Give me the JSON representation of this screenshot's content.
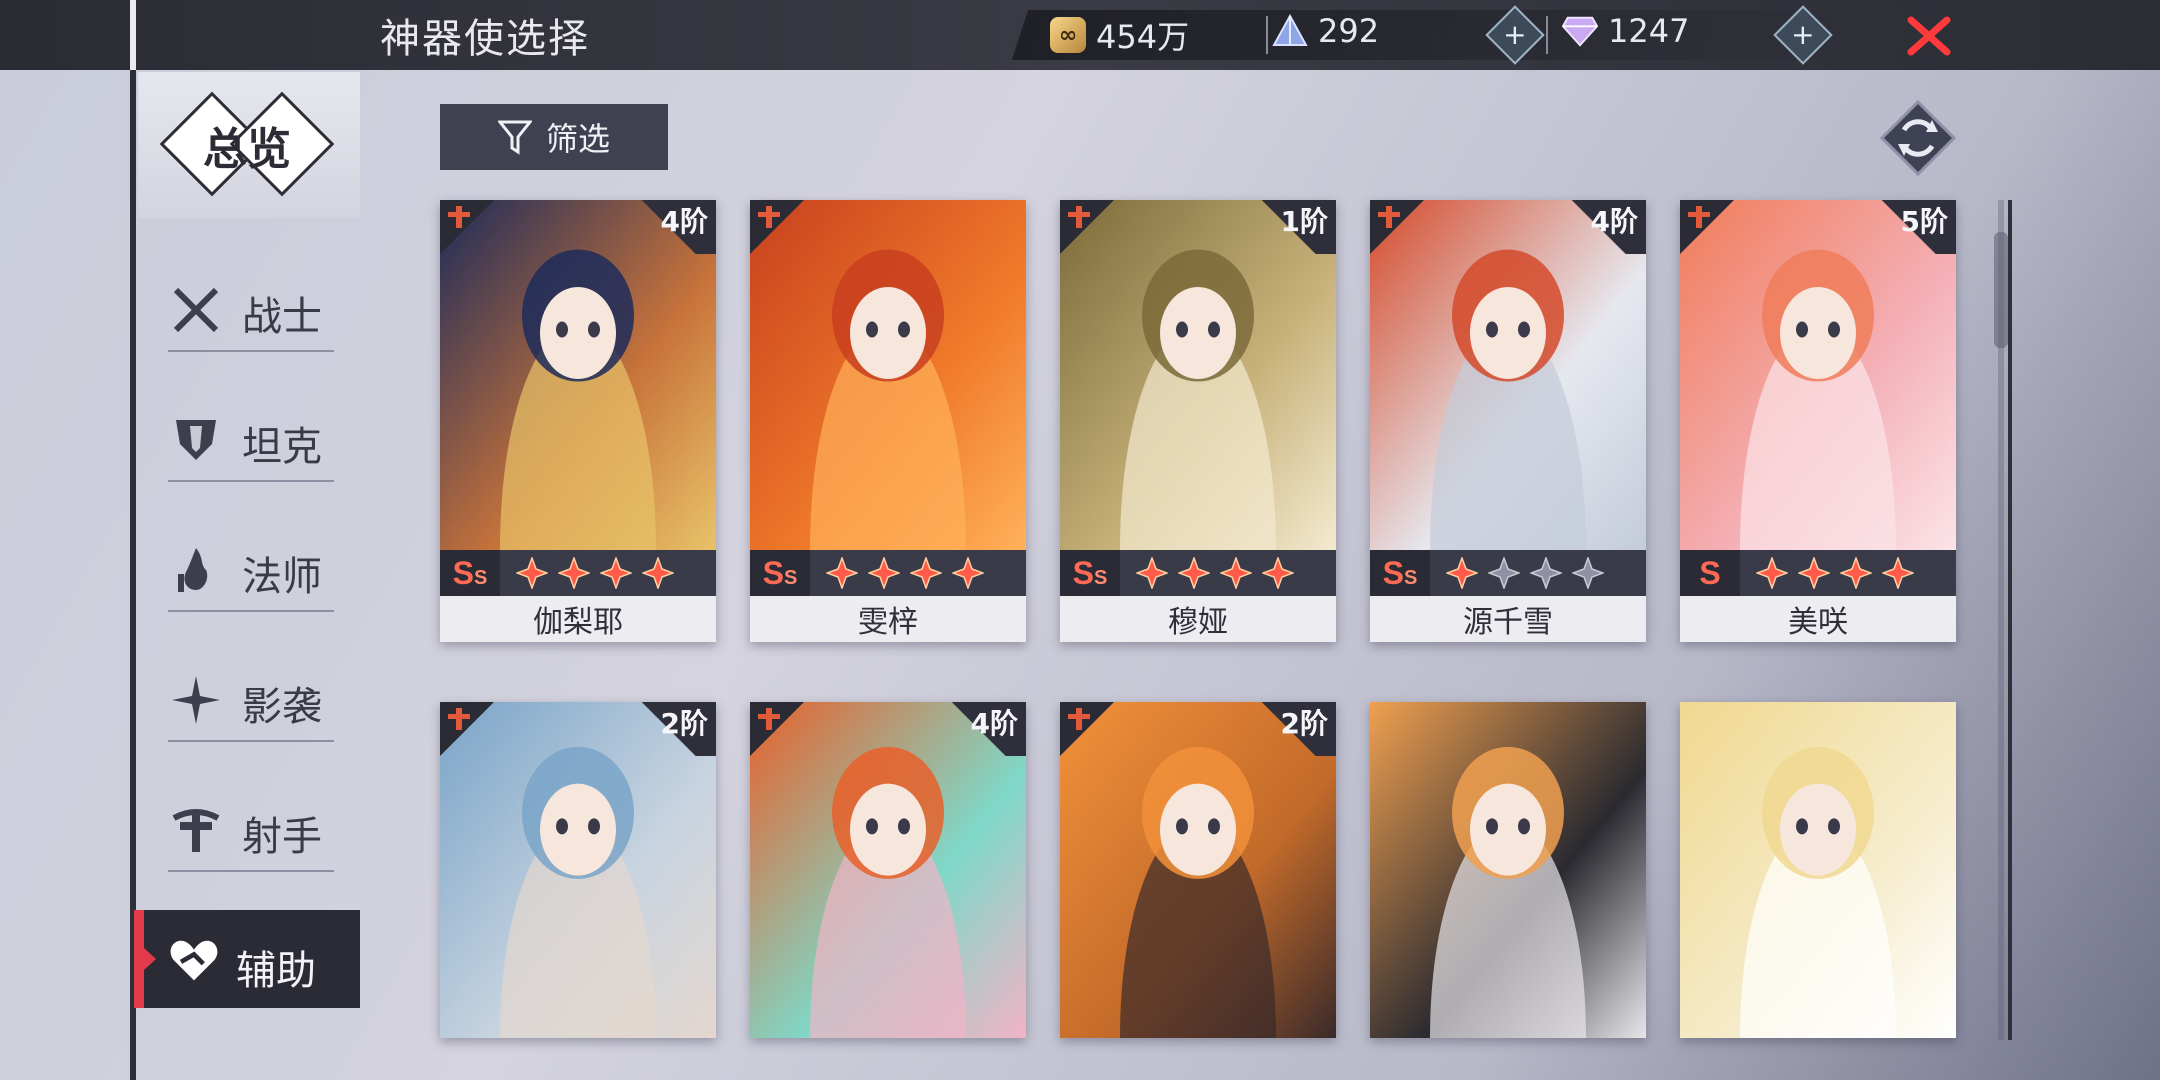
{
  "header": {
    "title": "神器使选择",
    "resources": [
      {
        "icon": "coin-icon",
        "value": "454万"
      },
      {
        "icon": "crystal-pyramid-icon",
        "value": "292"
      },
      {
        "icon": "diamond-icon",
        "value": "1247"
      }
    ]
  },
  "sidebar": {
    "overview_label": "总览",
    "items": [
      {
        "label": "战士",
        "icon": "crossed-swords-icon"
      },
      {
        "label": "坦克",
        "icon": "shield-icon"
      },
      {
        "label": "法师",
        "icon": "flame-staff-icon"
      },
      {
        "label": "影袭",
        "icon": "shuriken-icon"
      },
      {
        "label": "射手",
        "icon": "crossbow-icon"
      },
      {
        "label": "辅助",
        "icon": "heart-icon",
        "active": true
      }
    ]
  },
  "toolbar": {
    "filter_label": "筛选"
  },
  "cards_row1": [
    {
      "name": "伽梨耶",
      "tier": "4阶",
      "rank": "S",
      "rank_sub": "S",
      "stars_filled": 4,
      "stars_total": 4,
      "colors": [
        "#1d2b5a",
        "#c8733a",
        "#e8c36a"
      ]
    },
    {
      "name": "雯梓",
      "tier": "",
      "rank": "S",
      "rank_sub": "S",
      "stars_filled": 4,
      "stars_total": 4,
      "colors": [
        "#c8401e",
        "#f07a2a",
        "#ffb15a"
      ]
    },
    {
      "name": "穆娅",
      "tier": "1阶",
      "rank": "S",
      "rank_sub": "S",
      "stars_filled": 4,
      "stars_total": 4,
      "colors": [
        "#7b6b3a",
        "#c8b27a",
        "#f3ead0"
      ]
    },
    {
      "name": "源千雪",
      "tier": "4阶",
      "rank": "S",
      "rank_sub": "S",
      "stars_filled": 1,
      "stars_total": 4,
      "colors": [
        "#d44a2a",
        "#e6e8ef",
        "#c3ccd9"
      ]
    },
    {
      "name": "美咲",
      "tier": "5阶",
      "rank": "S",
      "rank_sub": "",
      "stars_filled": 4,
      "stars_total": 4,
      "colors": [
        "#f07c5a",
        "#f4b1b8",
        "#fbe4e8"
      ]
    }
  ],
  "cards_row2": [
    {
      "tier": "2阶",
      "colors": [
        "#7aa4c8",
        "#c8d4e0",
        "#e4d7cf"
      ]
    },
    {
      "tier": "4阶",
      "colors": [
        "#e8602a",
        "#7fd8c8",
        "#f2b3c6"
      ]
    },
    {
      "tier": "2阶",
      "colors": [
        "#f2913a",
        "#c26a2a",
        "#3a2a2a"
      ]
    },
    {
      "tier": "",
      "colors": [
        "#f0a050",
        "#2a2a30",
        "#e8e6ea"
      ]
    },
    {
      "tier": "",
      "colors": [
        "#f0d890",
        "#f6eccb",
        "#ffffff"
      ]
    }
  ]
}
